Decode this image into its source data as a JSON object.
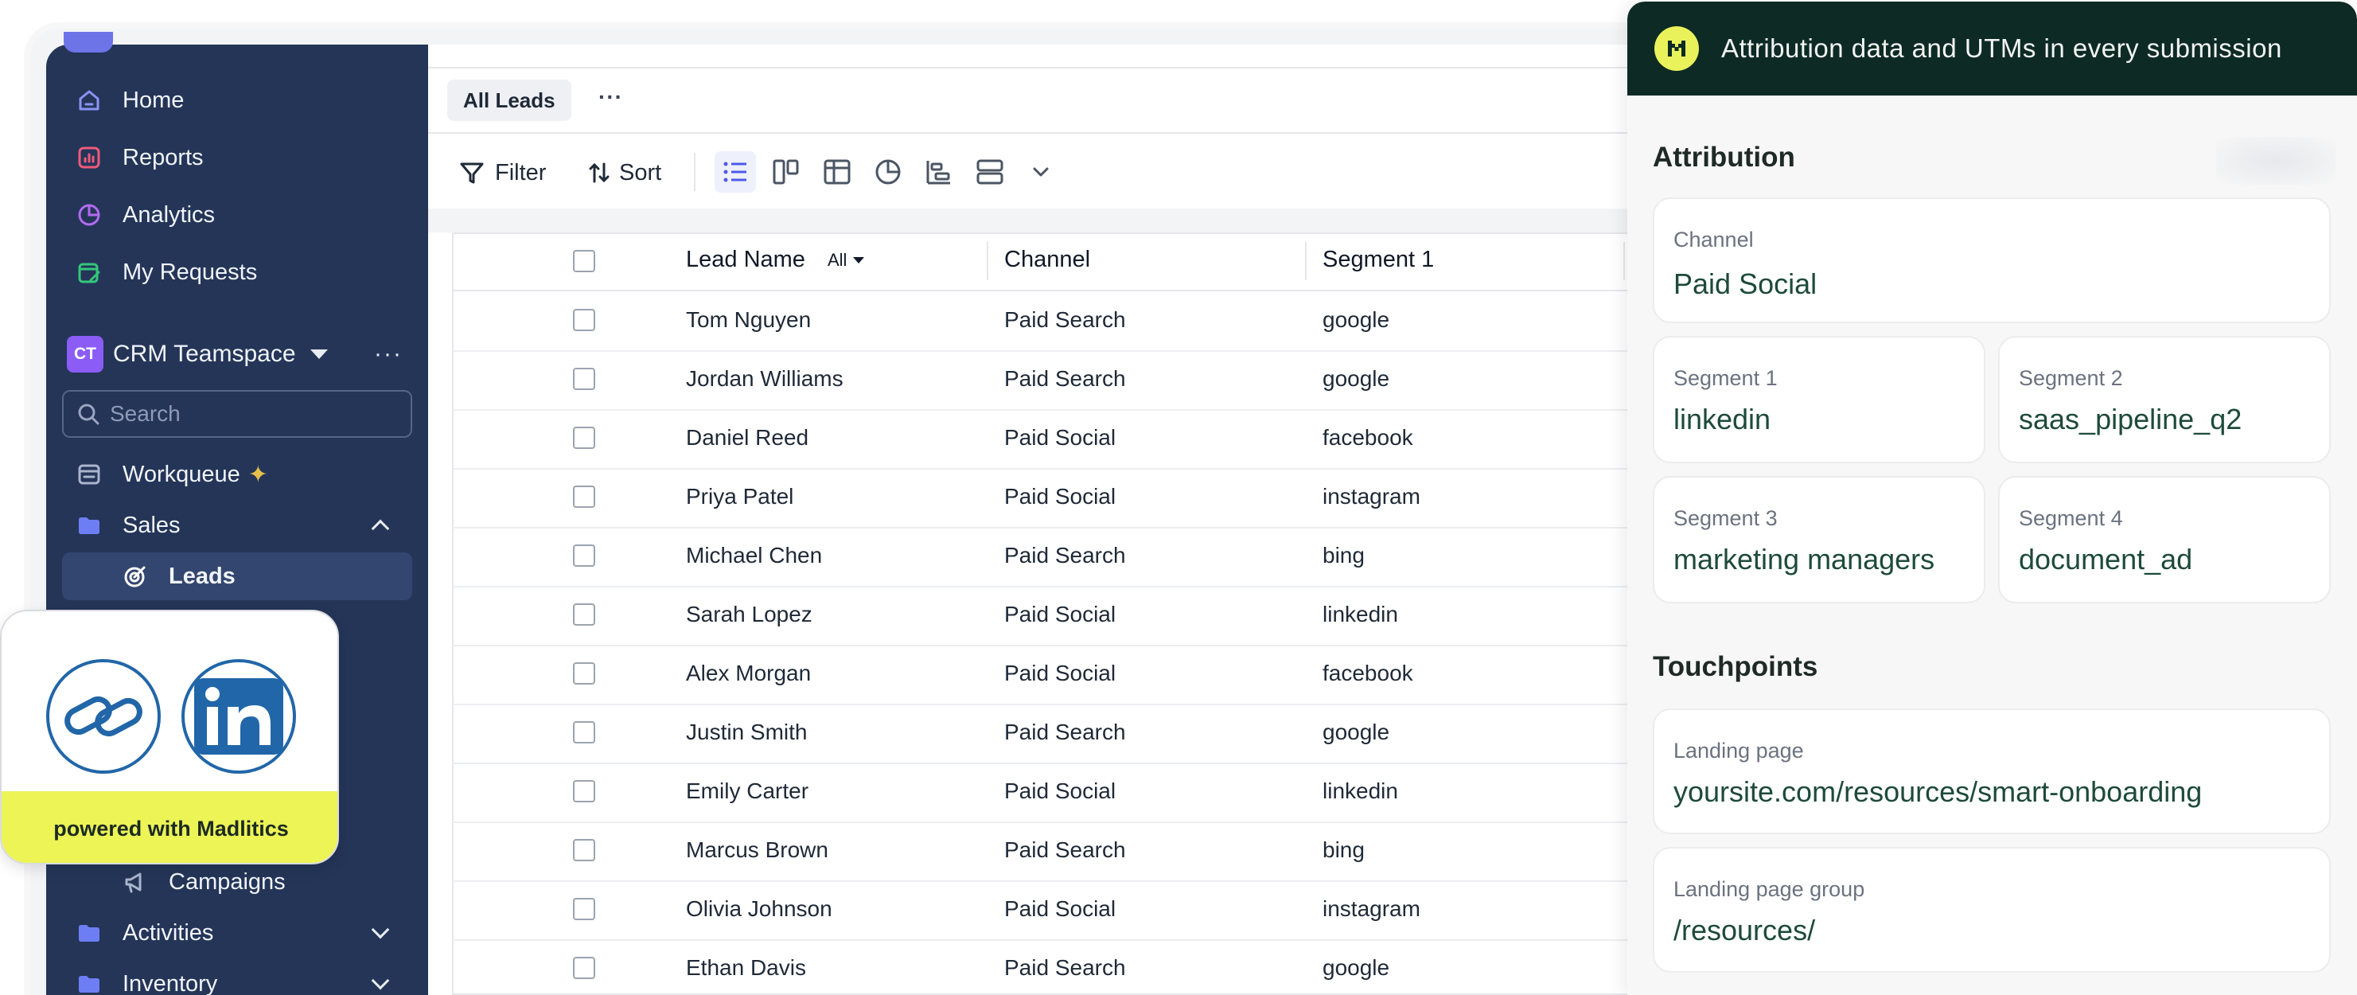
{
  "sidebar": {
    "nav": [
      {
        "label": "Home",
        "icon": "home-icon"
      },
      {
        "label": "Reports",
        "icon": "reports-icon"
      },
      {
        "label": "Analytics",
        "icon": "analytics-icon"
      },
      {
        "label": "My Requests",
        "icon": "requests-icon"
      }
    ],
    "team": {
      "badge": "CT",
      "name": "CRM Teamspace",
      "more": "···"
    },
    "search_placeholder": "Search",
    "workqueue": "Workqueue",
    "sales": "Sales",
    "leads": "Leads",
    "campaigns": "Campaigns",
    "activities": "Activities",
    "inventory": "Inventory"
  },
  "tabs": {
    "active": "All Leads",
    "more": "···"
  },
  "toolbar": {
    "filter": "Filter",
    "sort": "Sort"
  },
  "table": {
    "columns": [
      "Lead Name",
      "Channel",
      "Segment 1"
    ],
    "lead_filter": "All",
    "rows": [
      {
        "name": "Tom Nguyen",
        "channel": "Paid Search",
        "segment": "google"
      },
      {
        "name": "Jordan Williams",
        "channel": "Paid Search",
        "segment": "google"
      },
      {
        "name": "Daniel Reed",
        "channel": "Paid Social",
        "segment": "facebook"
      },
      {
        "name": "Priya Patel",
        "channel": "Paid Social",
        "segment": "instagram"
      },
      {
        "name": "Michael Chen",
        "channel": "Paid Search",
        "segment": "bing"
      },
      {
        "name": "Sarah Lopez",
        "channel": "Paid Social",
        "segment": "linkedin"
      },
      {
        "name": "Alex Morgan",
        "channel": "Paid Social",
        "segment": "facebook"
      },
      {
        "name": "Justin Smith",
        "channel": "Paid Search",
        "segment": "google"
      },
      {
        "name": "Emily Carter",
        "channel": "Paid Social",
        "segment": "linkedin"
      },
      {
        "name": "Marcus Brown",
        "channel": "Paid Search",
        "segment": "bing"
      },
      {
        "name": "Olivia Johnson",
        "channel": "Paid Social",
        "segment": "instagram"
      },
      {
        "name": "Ethan Davis",
        "channel": "Paid Search",
        "segment": "google"
      }
    ]
  },
  "panel": {
    "title": "Attribution data and UTMs in every submission",
    "attribution_title": "Attribution",
    "channel": {
      "label": "Channel",
      "value": "Paid Social"
    },
    "segment1": {
      "label": "Segment 1",
      "value": "linkedin"
    },
    "segment2": {
      "label": "Segment 2",
      "value": "saas_pipeline_q2"
    },
    "segment3": {
      "label": "Segment 3",
      "value": "marketing managers"
    },
    "segment4": {
      "label": "Segment 4",
      "value": "document_ad"
    },
    "touchpoints_title": "Touchpoints",
    "landing_page": {
      "label": "Landing page",
      "value": "yoursite.com/resources/smart-onboarding"
    },
    "landing_group": {
      "label": "Landing page group",
      "value": "/resources/"
    }
  },
  "powered": {
    "text": "powered with Madlitics"
  },
  "colors": {
    "sidebar": "#243558",
    "panel_header": "#0d2a24",
    "accent_yellow": "#ecf456",
    "value_green": "#1e4a3a",
    "linkedin_blue": "#2166a8"
  }
}
